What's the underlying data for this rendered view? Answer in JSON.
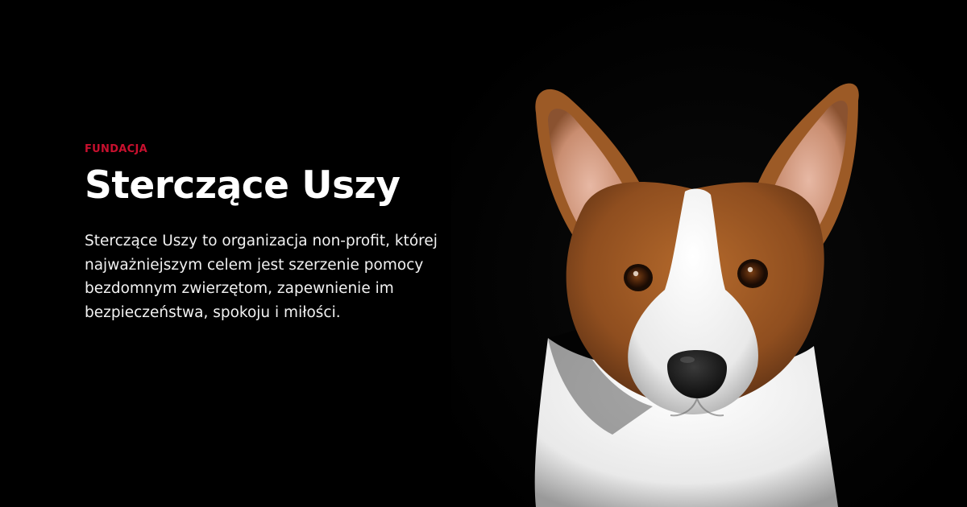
{
  "hero": {
    "eyebrow": "FUNDACJA",
    "title": "Sterczące Uszy",
    "description": "Sterczące Uszy to organizacja non-profit, której najważniejszym celem jest szerzenie pomocy bezdomnym zwierzętom, zapewnienie im bezpieczeństwa, spokoju i miłości."
  },
  "colors": {
    "background": "#000000",
    "accent": "#c8102e",
    "title": "#ffffff",
    "text": "#f2f2f2"
  },
  "image": {
    "icon": "corgi-dog-photo"
  }
}
